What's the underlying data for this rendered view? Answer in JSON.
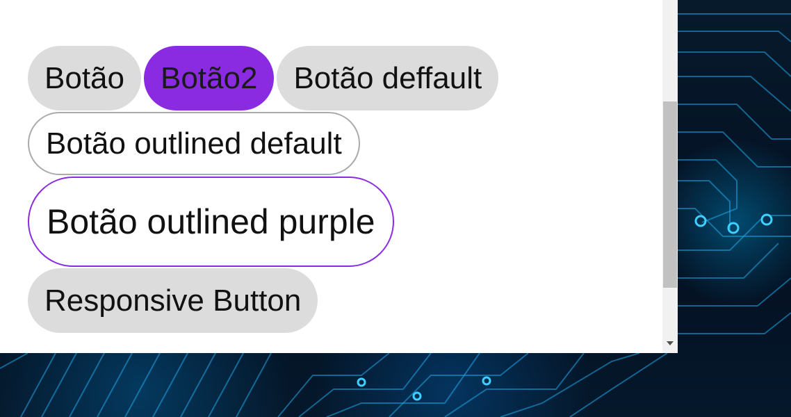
{
  "buttons": {
    "default": "Botão",
    "purple": "Botão2",
    "default2": "Botão deffault",
    "outlined_default": "Botão outlined default",
    "outlined_purple": "Botão outlined purple",
    "responsive": "Responsive Button"
  },
  "colors": {
    "purple": "#8a2be2",
    "default_bg": "#dcdcdc",
    "outline_gray": "#aaaaaa"
  },
  "icons": {
    "scroll_down": "triangle-down"
  }
}
